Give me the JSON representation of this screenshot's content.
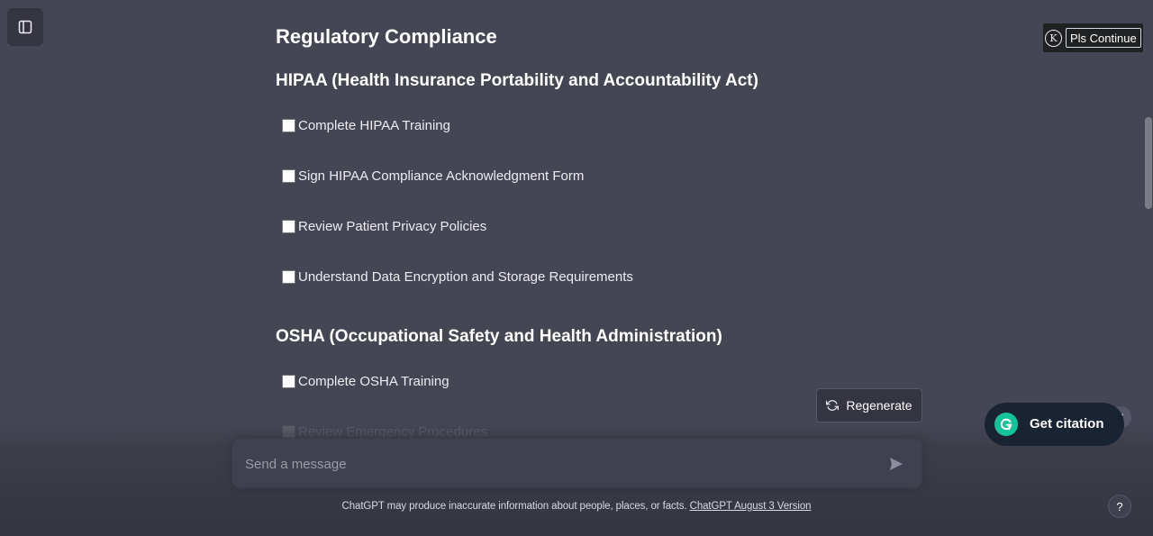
{
  "sidebar": {
    "toggle_icon": "sidebar-toggle-icon"
  },
  "message": {
    "title": "Regulatory Compliance",
    "sections": [
      {
        "heading": "HIPAA (Health Insurance Portability and Accountability Act)",
        "items": [
          {
            "label": "Complete HIPAA Training",
            "checked": false
          },
          {
            "label": "Sign HIPAA Compliance Acknowledgment Form",
            "checked": false
          },
          {
            "label": "Review Patient Privacy Policies",
            "checked": false
          },
          {
            "label": "Understand Data Encryption and Storage Requirements",
            "checked": false
          }
        ]
      },
      {
        "heading": "OSHA (Occupational Safety and Health Administration)",
        "items": [
          {
            "label": "Complete OSHA Training",
            "checked": false
          },
          {
            "label": "Review Emergency Procedures",
            "checked": false
          }
        ]
      }
    ]
  },
  "extension": {
    "logo_letter": "K",
    "button_label": "Pls Continue"
  },
  "regenerate": {
    "label": "Regenerate",
    "icon": "refresh-icon"
  },
  "composer": {
    "placeholder": "Send a message",
    "value": "",
    "send_icon": "send-icon"
  },
  "footer": {
    "disclaimer": "ChatGPT may produce inaccurate information about people, places, or facts.",
    "version_link": "ChatGPT August 3 Version"
  },
  "grammarly": {
    "citation_label": "Get citation"
  },
  "help": {
    "label": "?"
  },
  "colors": {
    "background": "#444654",
    "composer": "#40414f",
    "citation_bg": "#1a2333",
    "grammarly_green": "#15c39a"
  }
}
